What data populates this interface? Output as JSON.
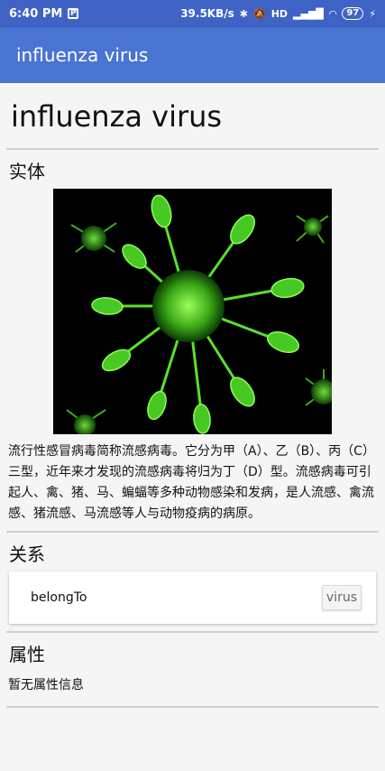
{
  "statusbar": {
    "time": "6:40 PM",
    "app_icon": "P",
    "speed": "39.5KB/s",
    "bluetooth": "bluetooth-icon",
    "mute": "mute-icon",
    "hd": "HD",
    "battery": "97"
  },
  "appbar": {
    "title": "influenza virus"
  },
  "page": {
    "title": "influenza virus",
    "entity_heading": "实体",
    "description": "流行性感冒病毒简称流感病毒。它分为甲（A）、乙（B）、丙（C）三型，近年来才发现的流感病毒将归为丁（D）型。流感病毒可引起人、禽、猪、马、蝙蝠等多种动物感染和发病，是人流感、禽流感、猪流感、马流感等人与动物疫病的病原。",
    "relation_heading": "关系",
    "relation": {
      "label": "belongTo",
      "target": "virus"
    },
    "attribute_heading": "属性",
    "no_attribute_text": "暂无属性信息"
  }
}
